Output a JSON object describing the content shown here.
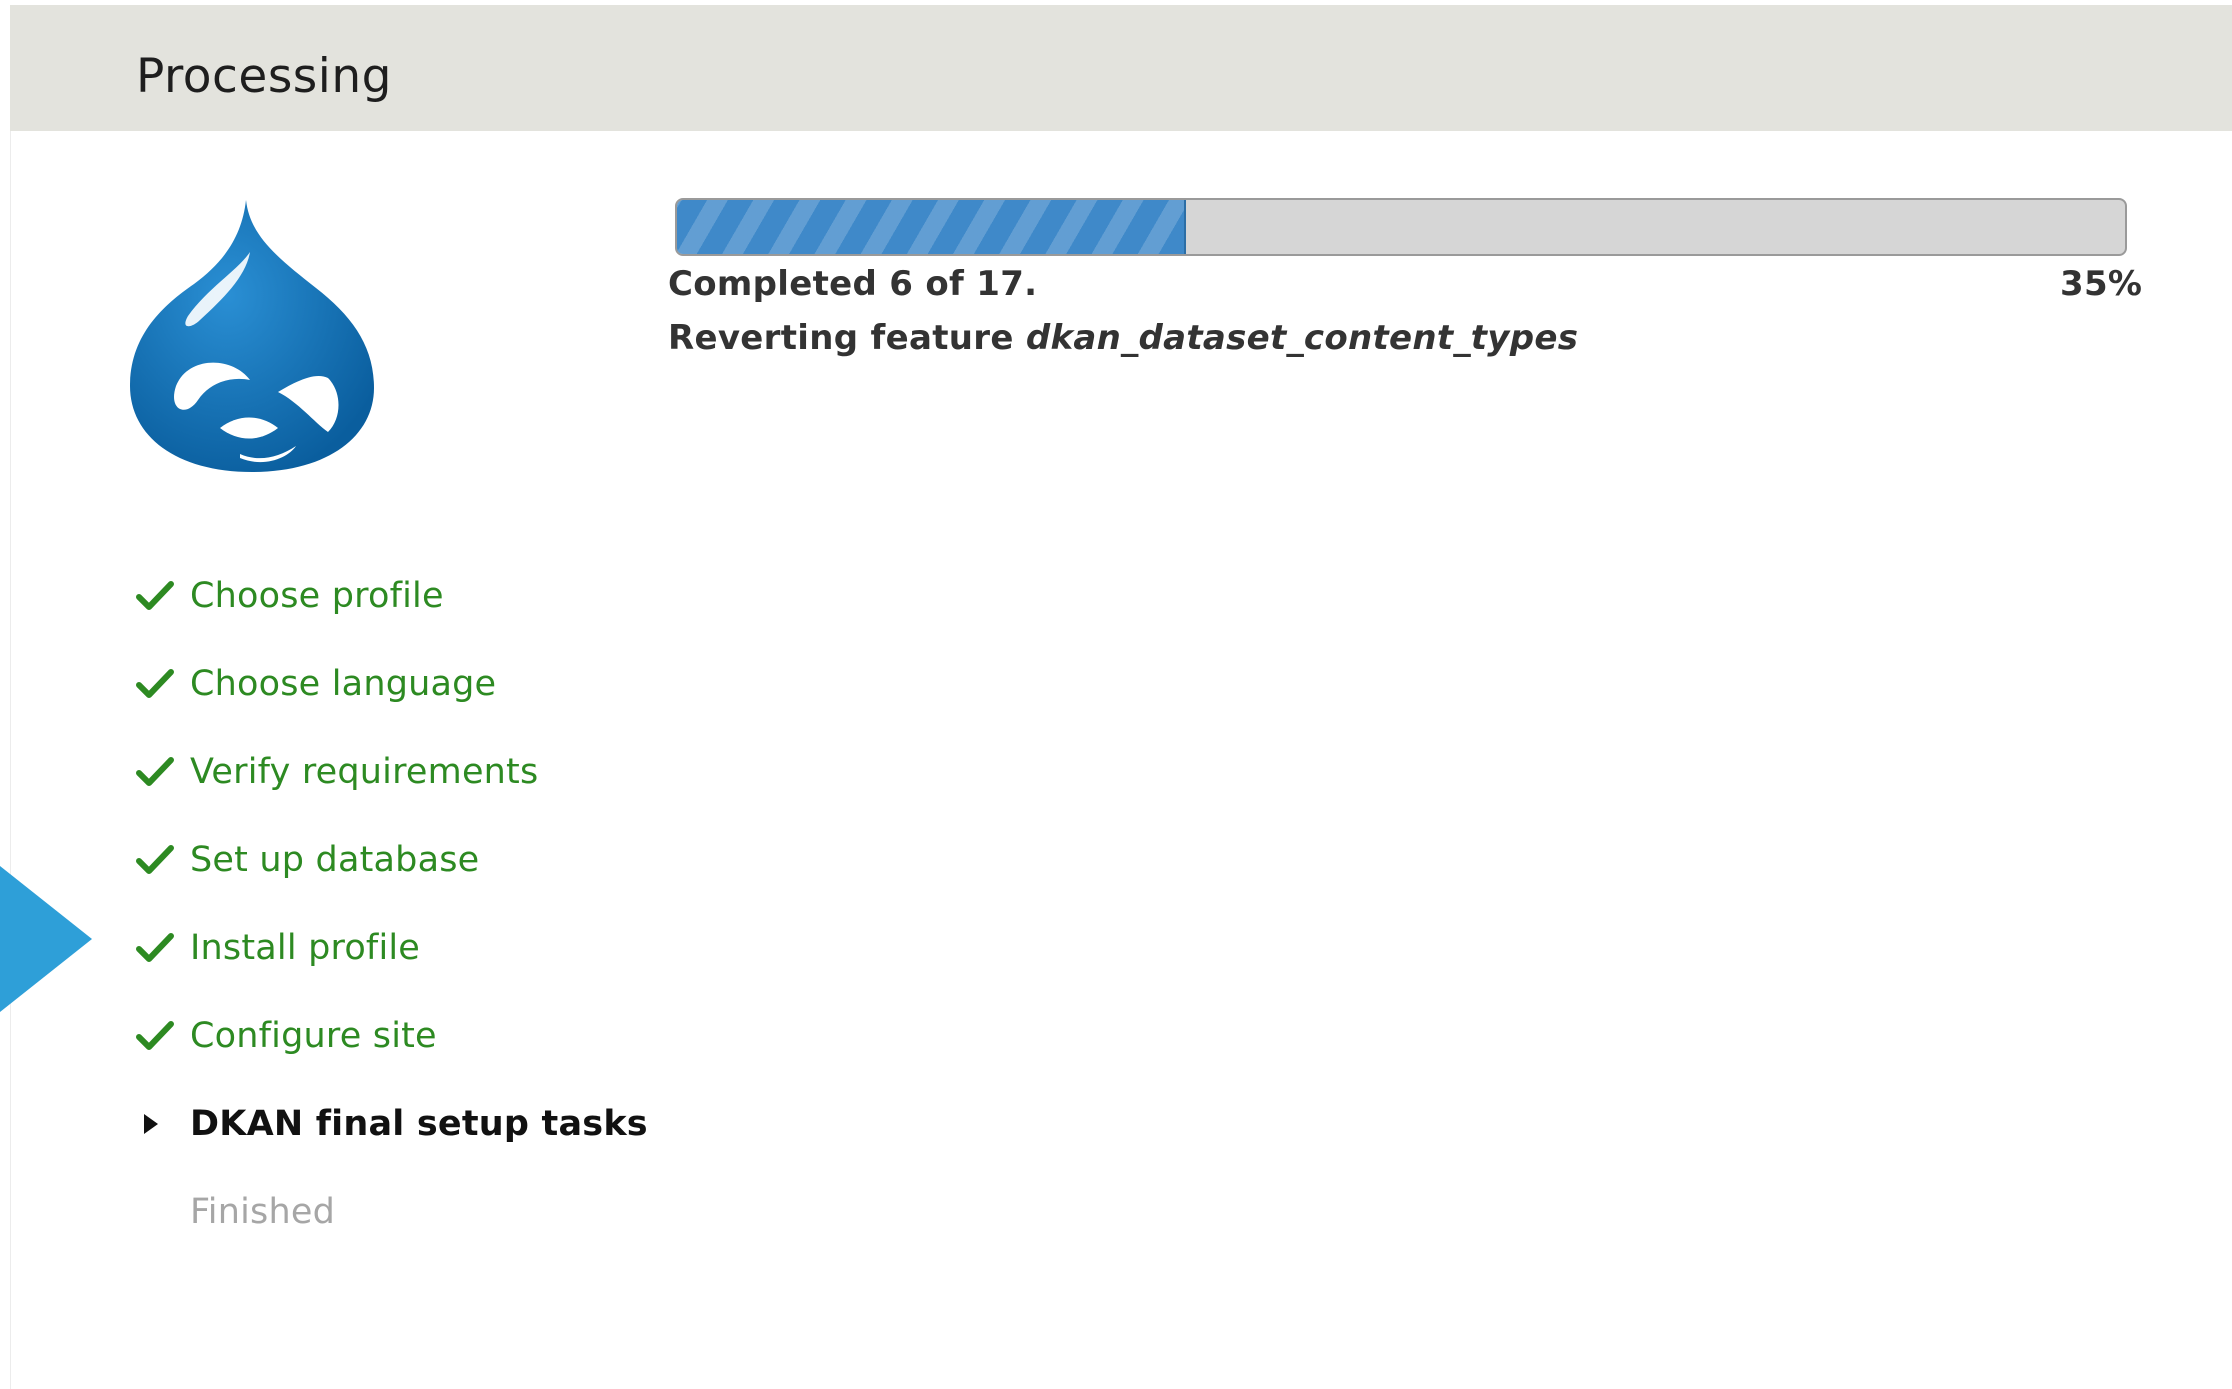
{
  "header": {
    "title": "Processing"
  },
  "logo": {
    "icon": "drupal-drop-icon",
    "color": "#0a74b8"
  },
  "pointer": {
    "icon": "pointer-arrow-icon",
    "color": "#2e9fd8"
  },
  "steps": [
    {
      "label": "Choose profile",
      "status": "done"
    },
    {
      "label": "Choose language",
      "status": "done"
    },
    {
      "label": "Verify requirements",
      "status": "done"
    },
    {
      "label": "Set up database",
      "status": "done"
    },
    {
      "label": "Install profile",
      "status": "done"
    },
    {
      "label": "Configure site",
      "status": "done"
    },
    {
      "label": "DKAN final setup tasks",
      "status": "current"
    },
    {
      "label": "Finished",
      "status": "pending"
    }
  ],
  "progress": {
    "percent_value": 35,
    "percent_label": "35%",
    "status_text": "Completed 6 of 17.",
    "message_prefix": "Reverting feature",
    "message_item": "dkan_dataset_content_types",
    "fill_color": "#3f89c9"
  },
  "colors": {
    "done": "#2d8a22",
    "current": "#111111",
    "pending": "#a6a6a6",
    "header_bg": "#e3e3dd"
  }
}
